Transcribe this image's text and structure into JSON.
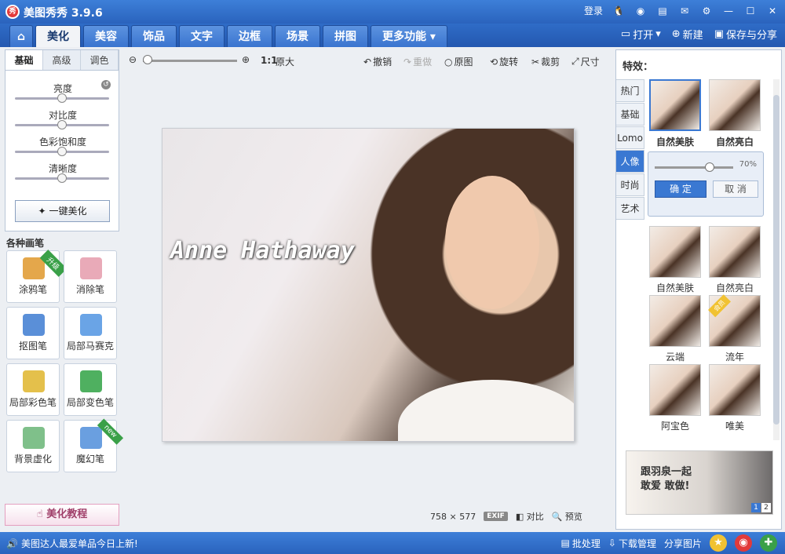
{
  "titlebar": {
    "app_logo": "秀",
    "title": "美图秀秀 3.9.6",
    "login": "登录",
    "icons": [
      "qq-icon",
      "weibo-icon",
      "note-icon",
      "mail-icon",
      "settings-icon"
    ],
    "min": "—",
    "max": "☐",
    "close": "✕"
  },
  "tabs": [
    {
      "id": "home",
      "label": "⌂"
    },
    {
      "id": "beautify",
      "label": "美化"
    },
    {
      "id": "face",
      "label": "美容"
    },
    {
      "id": "decor",
      "label": "饰品"
    },
    {
      "id": "text",
      "label": "文字"
    },
    {
      "id": "border",
      "label": "边框"
    },
    {
      "id": "scene",
      "label": "场景"
    },
    {
      "id": "collage",
      "label": "拼图"
    },
    {
      "id": "more",
      "label": "更多功能 ▾"
    }
  ],
  "active_tab": "beautify",
  "toolbar": {
    "open": "打开",
    "new": "新建",
    "save": "保存与分享"
  },
  "left_panel": {
    "subtabs": [
      "基础",
      "高级",
      "调色"
    ],
    "active_subtab": 0,
    "sliders": [
      {
        "label": "亮度",
        "value": 0.5
      },
      {
        "label": "对比度",
        "value": 0.5
      },
      {
        "label": "色彩饱和度",
        "value": 0.5
      },
      {
        "label": "清晰度",
        "value": 0.5
      }
    ],
    "one_click": "一键美化",
    "pen_section_title": "各种画笔",
    "pens": [
      {
        "label": "涂鸦笔",
        "ribbon": "升级"
      },
      {
        "label": "消除笔",
        "ribbon": ""
      },
      {
        "label": "抠图笔",
        "ribbon": ""
      },
      {
        "label": "局部马赛克",
        "ribbon": ""
      },
      {
        "label": "局部彩色笔",
        "ribbon": ""
      },
      {
        "label": "局部变色笔",
        "ribbon": ""
      },
      {
        "label": "背景虚化",
        "ribbon": ""
      },
      {
        "label": "魔幻笔",
        "ribbon": "new"
      }
    ],
    "tutorial": "美化教程"
  },
  "canvas": {
    "zoom_value": 0.0,
    "ratio": "1:1",
    "original_size": "原大",
    "actions": {
      "undo": "撤销",
      "redo": "重做",
      "original": "原图",
      "rotate": "旋转",
      "crop": "裁剪",
      "resize": "尺寸"
    },
    "photo_caption": "Anne Hathaway",
    "width": "758",
    "height": "577",
    "exif": "EXIF",
    "compare": "对比",
    "preview": "预览"
  },
  "right_panel": {
    "title": "特效：",
    "categories": [
      "热门",
      "基础",
      "Lomo",
      "人像",
      "时尚",
      "艺术"
    ],
    "active_category": 3,
    "top_effects": [
      {
        "label": "自然美肤",
        "selected": true
      },
      {
        "label": "自然亮白",
        "selected": false
      }
    ],
    "popup": {
      "strength": 0.7,
      "strength_text": "70%",
      "ok": "确 定",
      "cancel": "取 消"
    },
    "effects": [
      {
        "label": "自然美肤",
        "badge": ""
      },
      {
        "label": "自然亮白",
        "badge": ""
      },
      {
        "label": "云端",
        "badge": ""
      },
      {
        "label": "流年",
        "badge": "会员"
      },
      {
        "label": "阿宝色",
        "badge": ""
      },
      {
        "label": "唯美",
        "badge": ""
      }
    ],
    "ad": {
      "text_line1": "跟羽泉一起",
      "text_line2": "敢爱 敢做!",
      "pages": [
        "1",
        "2"
      ],
      "active_page": 0
    }
  },
  "statusbar": {
    "message": "美图达人最爱单品今日上新!",
    "batch": "批处理",
    "download": "下载管理",
    "share": "分享图片"
  },
  "colors": {
    "accent": "#3a78d2",
    "titlebar": "#2a63bd"
  }
}
